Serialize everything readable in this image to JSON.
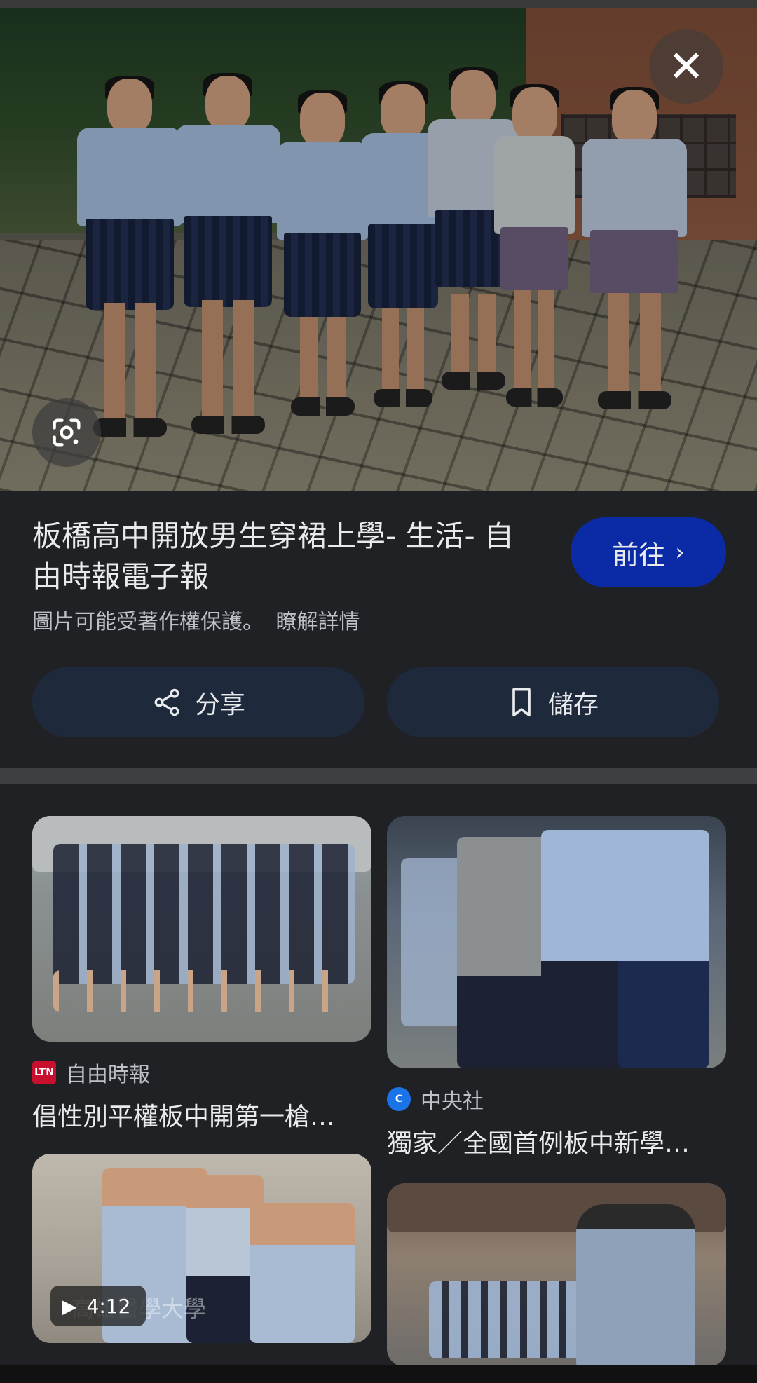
{
  "viewer": {
    "close_icon": "close-icon",
    "lens_icon": "google-lens-icon"
  },
  "result": {
    "title": "板橋高中開放男生穿裙上學- 生活- 自由時報電子報",
    "visit_label": "前往",
    "copyright_text": "圖片可能受著作權保護。",
    "learn_more": "瞭解詳情",
    "share_label": "分享",
    "save_label": "儲存"
  },
  "related": [
    {
      "source": "自由時報",
      "source_logo_text": "LTN",
      "title": "倡性別平權板中開第一槍…"
    },
    {
      "source": "中央社",
      "title": "獨家／全國首例板中新學…"
    },
    {
      "duration": "4:12",
      "overlay_text": "高雄醫學大學"
    },
    {}
  ],
  "colors": {
    "background": "#202124",
    "visit_button": "#0b2aa6",
    "action_button": "#1e2a3c"
  }
}
